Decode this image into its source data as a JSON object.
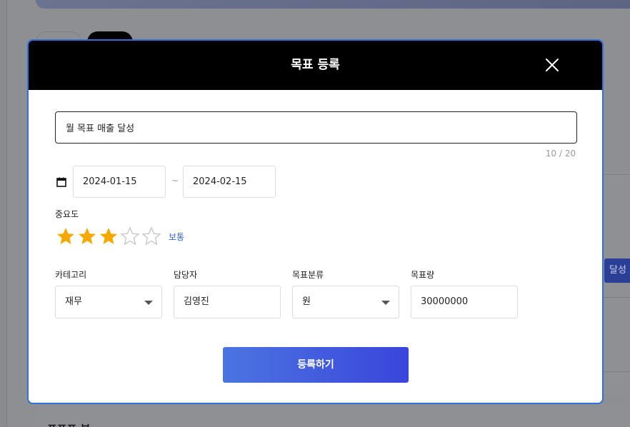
{
  "background": {
    "achieve_badge": "달성",
    "bottom_heading": "표표표 부"
  },
  "modal": {
    "title": "목표 등록",
    "goal_title_value": "월 목표 매출 달성",
    "char_count": "10 / 20",
    "start_date": "2024-01-15",
    "date_separator": "~",
    "end_date": "2024-02-15",
    "importance": {
      "label": "중요도",
      "rating": 3,
      "max": 5,
      "text": "보통",
      "color_filled": "#f5a800",
      "color_empty": "#c8c8c8"
    },
    "fields": {
      "category": {
        "label": "카테고리",
        "value": "재무"
      },
      "owner": {
        "label": "담당자",
        "value": "김영진"
      },
      "goal_type": {
        "label": "목표분류",
        "value": "원"
      },
      "goal_amount": {
        "label": "목표량",
        "value": "30000000"
      }
    },
    "submit_label": "등록하기"
  },
  "icons": {
    "close": "close-icon",
    "calendar": "calendar-icon",
    "star": "star-icon",
    "dropdown": "chevron-down-icon"
  },
  "colors": {
    "header_bg": "#000000",
    "modal_border": "#2f6fe0",
    "link_blue": "#2f5fd0",
    "button_gradient_start": "#4b75e0",
    "button_gradient_end": "#3a45dc"
  }
}
